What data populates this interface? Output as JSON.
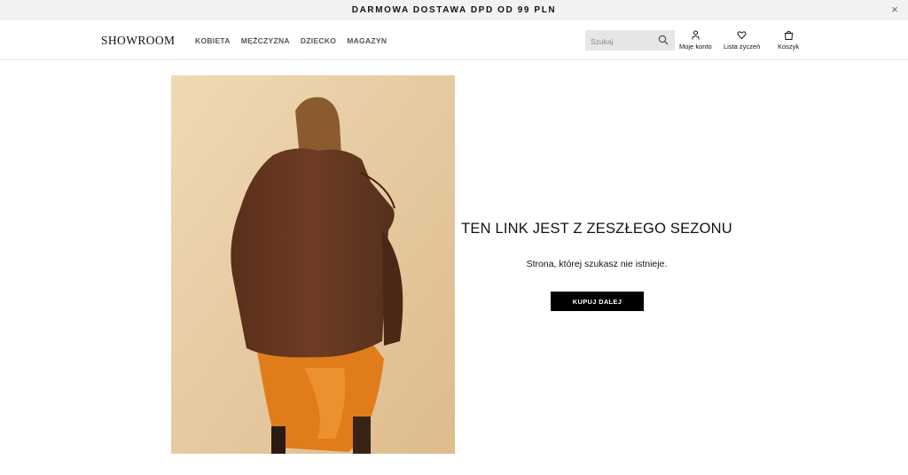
{
  "announcement": {
    "text": "DARMOWA DOSTAWA DPD OD 99 PLN",
    "close_symbol": "×"
  },
  "header": {
    "logo": "SHOWROOM",
    "nav": [
      {
        "label": "KOBIETA"
      },
      {
        "label": "MĘŻCZYZNA"
      },
      {
        "label": "DZIECKO"
      },
      {
        "label": "MAGAZYN"
      }
    ],
    "search": {
      "placeholder": "Szukaj",
      "icon": "search-icon"
    },
    "account": {
      "label": "Moje konto",
      "icon": "user-icon"
    },
    "wishlist": {
      "label": "Lista życzeń",
      "icon": "heart-icon"
    },
    "cart": {
      "label": "Koszyk",
      "icon": "bag-icon"
    }
  },
  "main": {
    "headline": "TEN LINK JEST Z ZESZŁEGO SEZONU",
    "message": "Strona, której szukasz nie istnieje.",
    "cta_label": "KUPUJ DALEJ"
  },
  "colors": {
    "announcement_bg": "#f2f2f2",
    "search_bg": "#e6e6e6",
    "cta_bg": "#000000",
    "photo_bg": "#e8cfa8",
    "coat": "#6b3a23",
    "skirt": "#e07d1a"
  }
}
